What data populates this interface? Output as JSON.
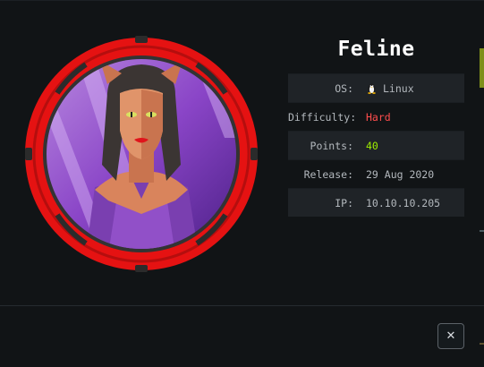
{
  "machine": {
    "name": "Feline",
    "avatar_icon": "feline-avatar-icon",
    "ring_color": "#e51b1b"
  },
  "info": {
    "rows": [
      {
        "label": "OS:",
        "value": "Linux",
        "icon": "linux-penguin-icon"
      },
      {
        "label": "Difficulty:",
        "value": "Hard",
        "color": "#ff4d4d"
      },
      {
        "label": "Points:",
        "value": "40",
        "color": "#9fef00"
      },
      {
        "label": "Release:",
        "value": "29 Aug 2020"
      },
      {
        "label": "IP:",
        "value": "10.10.10.205"
      }
    ]
  },
  "footer": {
    "close_label": "✕",
    "close_icon": "close-icon"
  }
}
